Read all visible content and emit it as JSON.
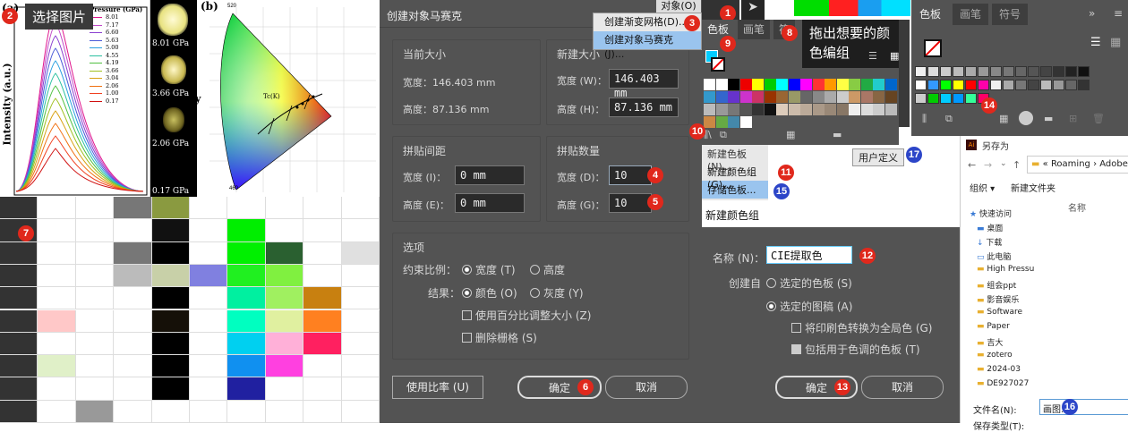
{
  "callout_top": "选择图片",
  "chart_b_label": "(b)",
  "chart_a_label": "(a)",
  "legend_title": "Pressure (GPa)",
  "pressures": [
    "8.01",
    "7.17",
    "6.60",
    "5.63",
    "5.00",
    "4.55",
    "4.19",
    "3.66",
    "3.04",
    "2.06",
    "1.00",
    "0.17"
  ],
  "ylabel": "Intensity (a.u.)",
  "photo_labels": [
    "8.01 GPa",
    "3.66 GPa",
    "2.06 GPa",
    "0.17 GPa"
  ],
  "cie": {
    "y_label": "y",
    "t_label": "Tc(K)",
    "ticks_top": [
      "520",
      "540",
      "560",
      "580",
      "600",
      "620"
    ],
    "ticks_left": [
      "500",
      "490",
      "480",
      "470",
      "460"
    ]
  },
  "dialog": {
    "menu_object": "对象(O)",
    "title": "创建对象马赛克",
    "cur_size": "当前大小",
    "cur_w": "宽度：146.403 mm",
    "cur_h": "高度：87.136 mm",
    "new_size": "新建大小",
    "new_w_label": "宽度 (W)：",
    "new_w": "146.403 mm",
    "new_h_label": "高度 (H)：",
    "new_h": "87.136 mm",
    "spacing": "拼贴间距",
    "sp_w_label": "宽度 (I)：",
    "sp_w": "0 mm",
    "sp_h_label": "高度 (E)：",
    "sp_h": "0 mm",
    "count": "拼贴数量",
    "cnt_w_label": "宽度 (D)：",
    "cnt_w": "10",
    "cnt_h_label": "高度 (G)：",
    "cnt_h": "10",
    "options": "选项",
    "ratio_label": "约束比例：",
    "ratio_w": "宽度 (T)",
    "ratio_h": "高度",
    "result_label": "结果：",
    "res_color": "颜色 (O)",
    "res_gray": "灰度 (Y)",
    "pct": "使用百分比调整大小 (Z)",
    "del": "删除栅格 (S)",
    "use_ratio": "使用比率 (U)",
    "ok": "确定",
    "cancel": "取消"
  },
  "context_menu": [
    "创建渐变网格(D)...",
    "创建对象马赛克(J)..."
  ],
  "swatch_panel": {
    "tab1": "色板",
    "tab2": "画笔",
    "tab3": "符",
    "menu": [
      "新建色板(N)...",
      "新建颜色组(G)...",
      "存储色板..."
    ],
    "user_def": "用户定义"
  },
  "callout_right": "拖出想要的颜色编组",
  "panel2": {
    "tab1": "色板",
    "tab2": "画笔",
    "tab3": "符号",
    "more": "»"
  },
  "new_group": {
    "title": "新建颜色组",
    "name_label": "名称 (N)：",
    "name_value": "CIE提取色",
    "create_from": "创建自",
    "opt1": "选定的色板 (S)",
    "opt2": "选定的图稿 (A)",
    "chk1": "将印刷色转换为全局色 (G)",
    "chk2": "包括用于色调的色板 (T)",
    "ok": "确定",
    "cancel": "取消"
  },
  "save_dialog": {
    "title": "另存为",
    "path1": "Roaming",
    "path2": "Adobe",
    "organize": "组织 ▾",
    "new_folder": "新建文件夹",
    "col": "名称",
    "items": [
      "快速访问",
      "桌面",
      "下载",
      "此电脑",
      "High Pressu",
      "组会ppt",
      "影音娱乐",
      "Software",
      "Paper",
      "吉大",
      "zotero",
      "2024-03",
      "DE927027"
    ],
    "filename_label": "文件名(N):",
    "filename": "画图...",
    "type_label": "保存类型(T):"
  },
  "badges": [
    "1",
    "2",
    "3",
    "4",
    "5",
    "6",
    "7",
    "8",
    "9",
    "10",
    "11",
    "12",
    "13",
    "14",
    "15",
    "16",
    "17"
  ],
  "colors": {
    "accent_red": "#e0281c",
    "accent_blue": "#2c45c8",
    "panel_bg": "#535353",
    "dark_bg": "#323232"
  }
}
